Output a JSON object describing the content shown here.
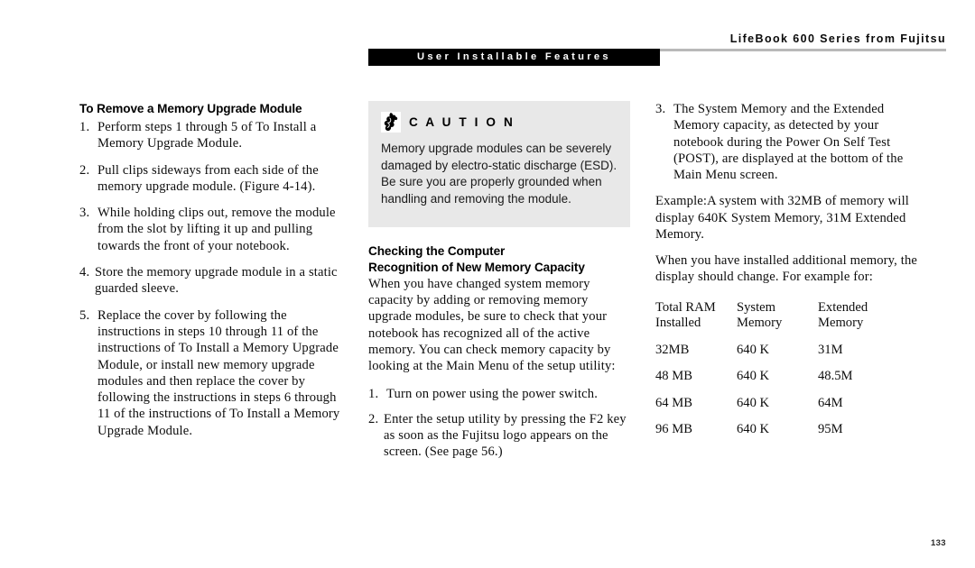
{
  "header": {
    "running_head": "LifeBook 600 Series from Fujitsu",
    "section_tab": "User Installable Features"
  },
  "left_column": {
    "heading": "To Remove a Memory Upgrade Module",
    "steps": [
      {
        "num": "1.",
        "text": "Perform steps 1 through 5 of To Install a Memory Upgrade Module."
      },
      {
        "num": "2.",
        "text": "Pull clips sideways from each side of the memory upgrade module. (Figure 4-14)."
      },
      {
        "num": "3.",
        "text": "While holding clips out, remove the module from the slot by lifting it up and pulling towards the front of your notebook."
      },
      {
        "num": "4.",
        "text": "Store the memory upgrade module in a static guarded sleeve."
      },
      {
        "num": "5.",
        "text": "Replace the cover by following the instructions in steps 10 through 11 of the instructions of To Install a Memory Upgrade Module, or install new memory upgrade modules and then replace the cover by following the instructions in steps 6 through 11 of the instructions of To Install a Memory Upgrade Module."
      }
    ]
  },
  "caution": {
    "icon": "caution-hand-icon",
    "title": "C A U T I O N",
    "body": "Memory upgrade modules can be severely damaged by electro-static discharge (ESD). Be sure you are properly grounded when handling and removing the module.",
    "background_color": "#e8e8e8"
  },
  "middle_column": {
    "heading_line1": "Checking the Computer",
    "heading_line2": "Recognition of New Memory Capacity",
    "body": "When you have changed system memory capacity by adding or removing memory upgrade modules, be sure to check that your notebook has recognized all of the active memory. You can check memory capacity by looking at the Main Menu of the setup utility:",
    "steps": [
      {
        "num": "1.",
        "text": "Turn on power using the power switch."
      },
      {
        "num": "2.",
        "text": "Enter the setup utility by pressing the F2 key as soon as the Fujitsu logo appears on the screen. (See page 56.)"
      }
    ]
  },
  "right_column": {
    "steps": [
      {
        "num": "3.",
        "text": "The System Memory and the Extended Memory capacity, as detected by your notebook during the Power On Self Test (POST), are displayed at the bottom of the Main Menu screen."
      }
    ],
    "paragraph_example": "Example:A  system with 32MB of memory will display 640K System Memory, 31M Extended Memory.",
    "paragraph_installed": "When you have installed additional memory, the display should change. For example for:",
    "table": {
      "headers_line1": [
        "Total RAM",
        "System",
        "Extended"
      ],
      "headers_line2": [
        "Installed",
        "Memory",
        "Memory"
      ],
      "rows": [
        [
          "32MB",
          "640 K",
          "31M"
        ],
        [
          "48 MB",
          "640 K",
          "48.5M"
        ],
        [
          "64 MB",
          "640 K",
          "64M"
        ],
        [
          "96 MB",
          "640 K",
          "95M"
        ]
      ]
    }
  },
  "footer": {
    "page_number": "133"
  }
}
